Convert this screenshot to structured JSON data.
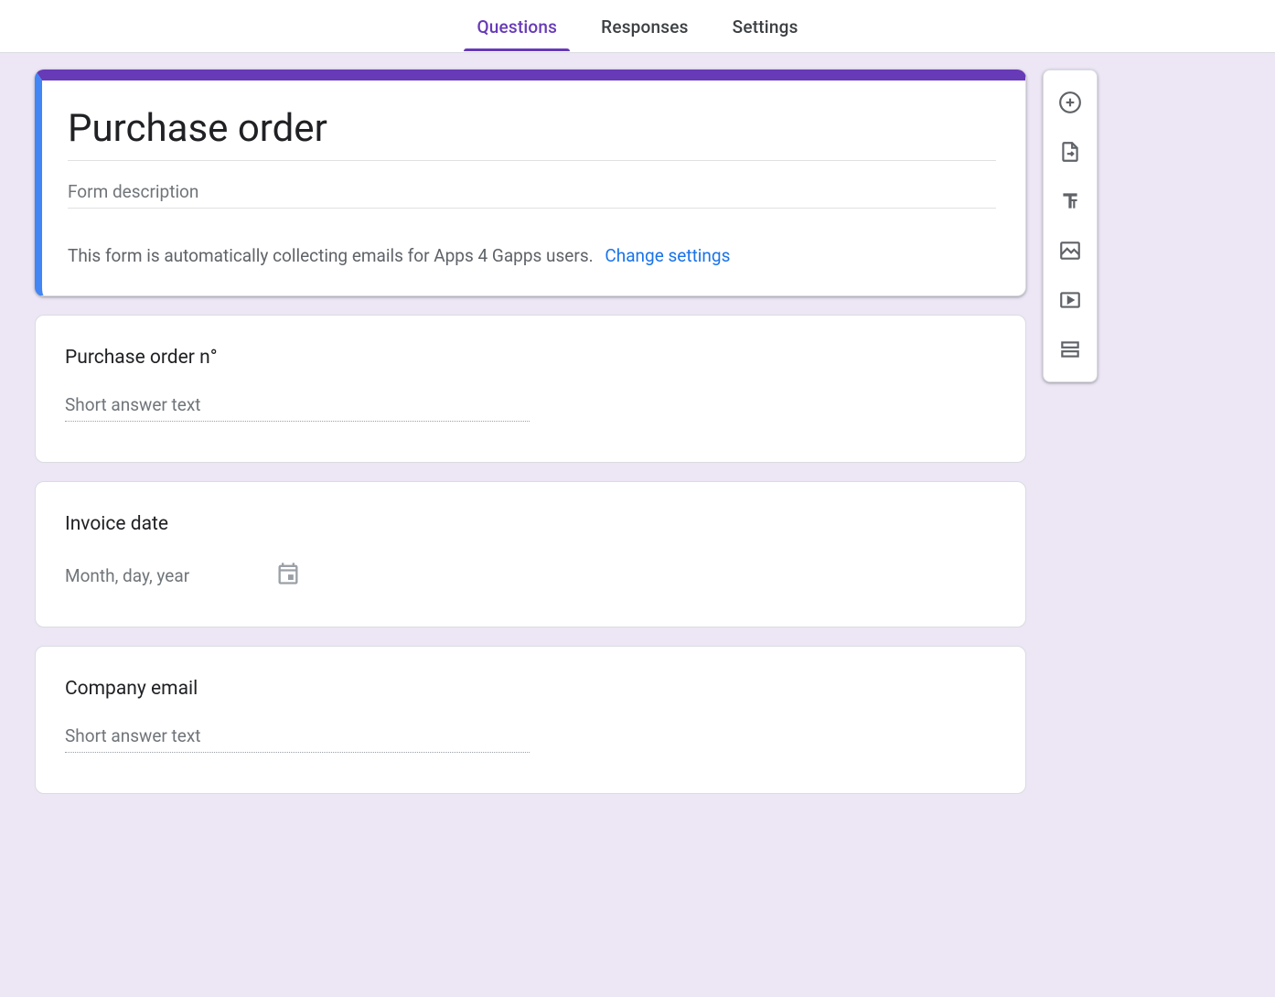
{
  "tabs": {
    "questions": "Questions",
    "responses": "Responses",
    "settings": "Settings"
  },
  "header": {
    "title": "Purchase order",
    "description_placeholder": "Form description",
    "email_notice": "This form is automatically collecting emails for Apps 4 Gapps users.",
    "change_settings": "Change settings"
  },
  "questions": [
    {
      "title": "Purchase order n°",
      "placeholder": "Short answer text",
      "type": "short_answer"
    },
    {
      "title": "Invoice date",
      "placeholder": "Month, day, year",
      "type": "date"
    },
    {
      "title": "Company email",
      "placeholder": "Short answer text",
      "type": "short_answer"
    }
  ],
  "toolbar": {
    "add_question": "Add question",
    "import_questions": "Import questions",
    "add_title": "Add title and description",
    "add_image": "Add image",
    "add_video": "Add video",
    "add_section": "Add section"
  }
}
